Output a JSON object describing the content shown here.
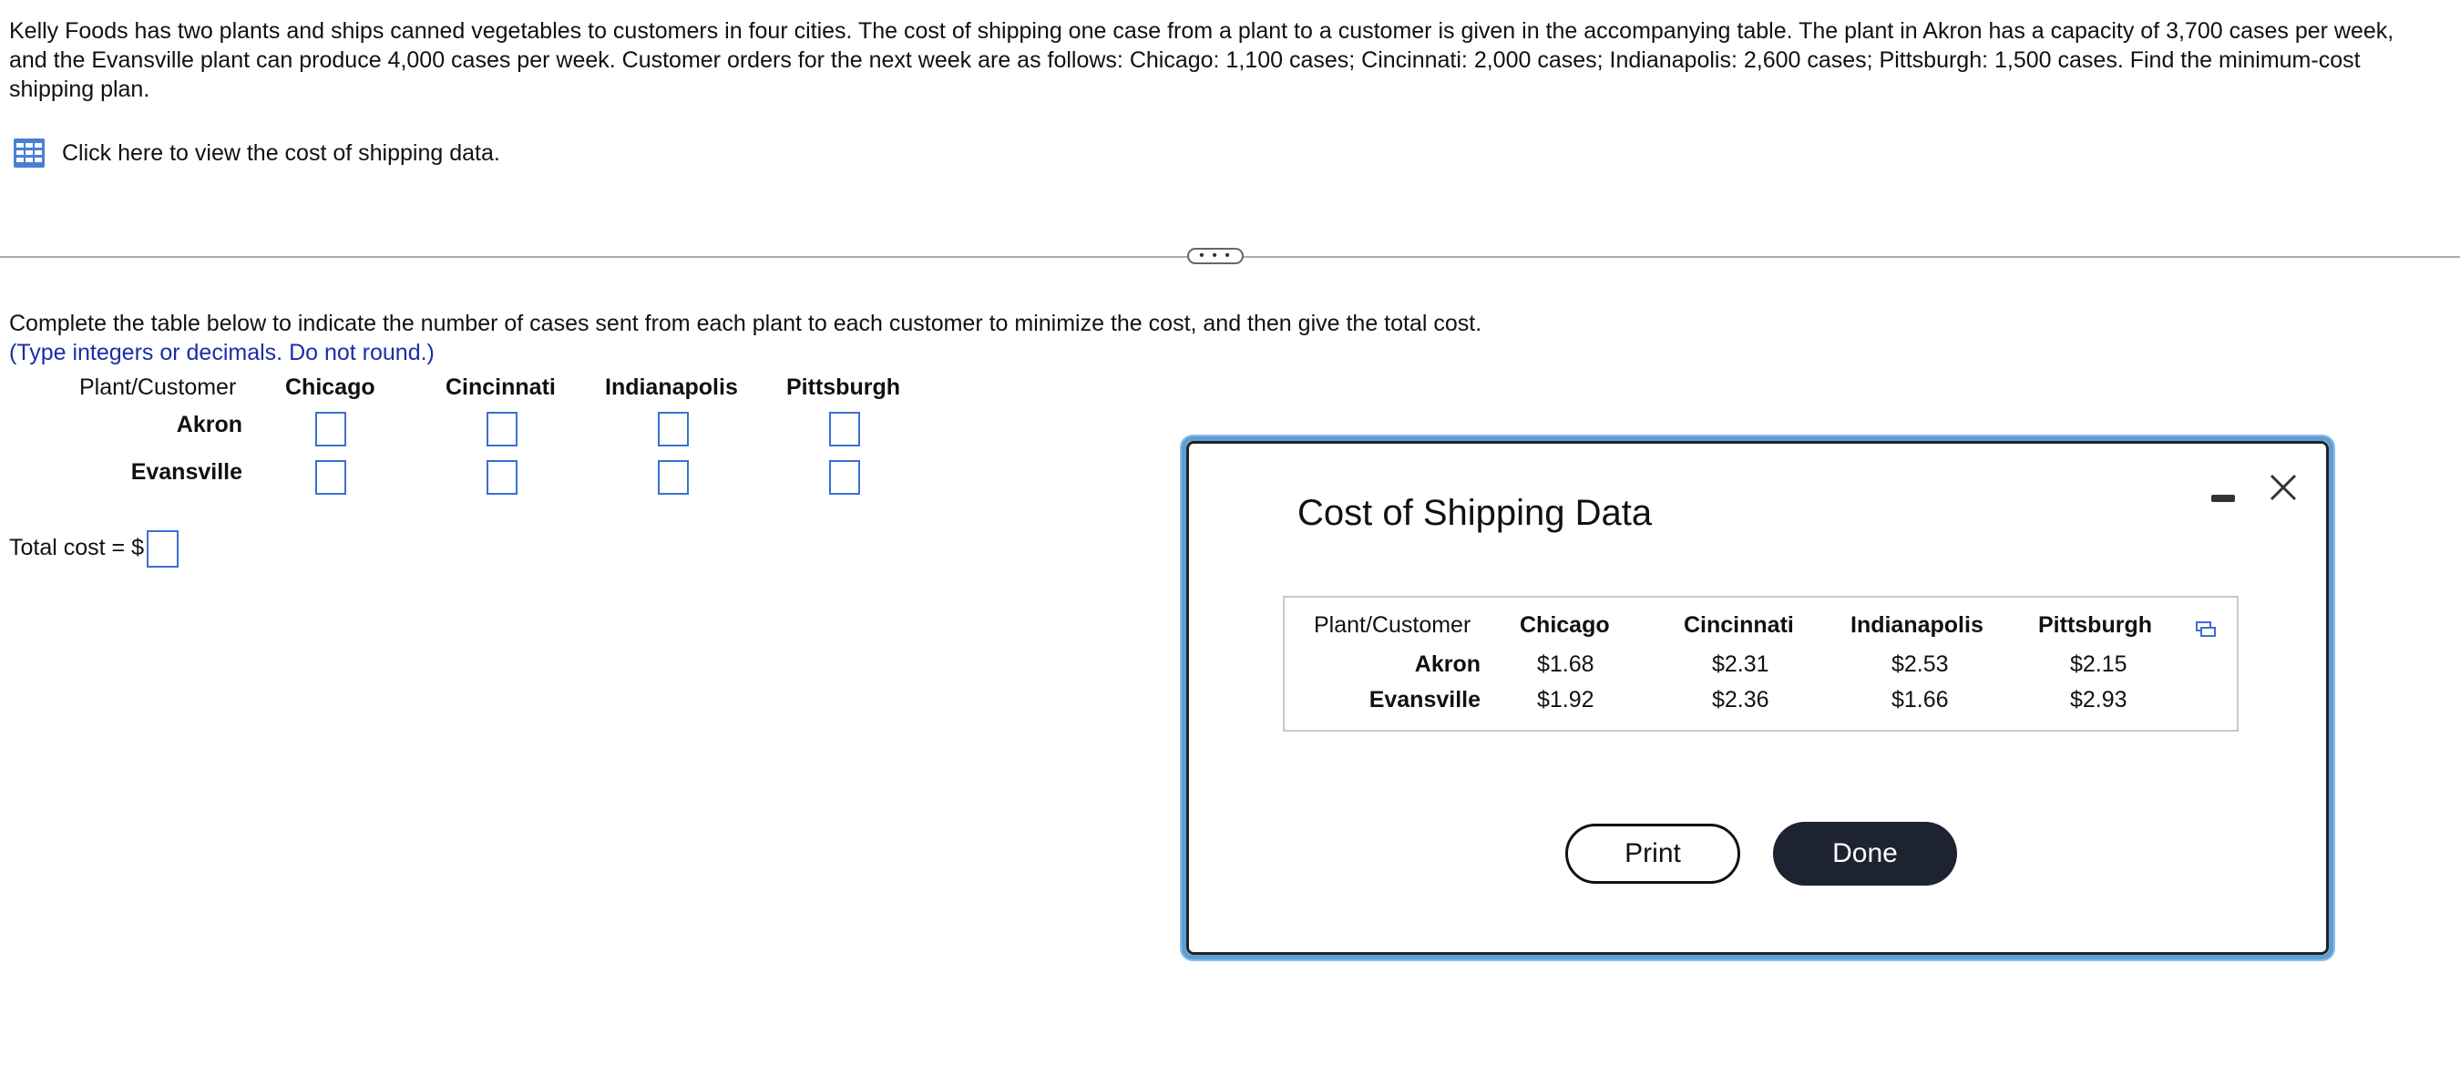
{
  "problem": {
    "text": "Kelly Foods has two plants and ships canned vegetables to customers in four cities. The cost of shipping one case from a plant to a customer is given in the accompanying table. The plant in Akron has a capacity of 3,700 cases per week, and the Evansville plant can produce 4,000 cases per week. Customer orders for the next week are as follows: Chicago: 1,100 cases; Cincinnati: 2,000 cases; Indianapolis: 2,600 cases; Pittsburgh: 1,500 cases. Find the minimum-cost shipping plan.",
    "data_link": "Click here to view the cost of shipping data.",
    "data_link_icon": "table-grid-icon"
  },
  "separator": {
    "handle_label": "• • •"
  },
  "question": {
    "instructions": "Complete the table below to indicate the number of cases sent from each plant to each customer to minimize the cost, and then give the total cost.",
    "hint": "(Type integers or decimals. Do not round.)",
    "table": {
      "corner": "Plant/Customer",
      "columns": [
        "Chicago",
        "Cincinnati",
        "Indianapolis",
        "Pittsburgh"
      ],
      "rows": [
        "Akron",
        "Evansville"
      ],
      "values": [
        [
          "",
          "",
          "",
          ""
        ],
        [
          "",
          "",
          "",
          ""
        ]
      ]
    },
    "total_label": "Total cost = $",
    "total_value": ""
  },
  "modal": {
    "title": "Cost of Shipping Data",
    "table": {
      "corner": "Plant/Customer",
      "columns": [
        "Chicago",
        "Cincinnati",
        "Indianapolis",
        "Pittsburgh"
      ],
      "rows": [
        {
          "label": "Akron",
          "values": [
            "$1.68",
            "$2.31",
            "$2.53",
            "$2.15"
          ]
        },
        {
          "label": "Evansville",
          "values": [
            "$1.92",
            "$2.36",
            "$1.66",
            "$2.93"
          ]
        }
      ]
    },
    "print_label": "Print",
    "done_label": "Done"
  },
  "colors": {
    "accent_blue": "#3c6fd1",
    "hint_blue": "#1a2da8",
    "modal_border": "#5b9fd6",
    "done_button": "#1d2331"
  }
}
